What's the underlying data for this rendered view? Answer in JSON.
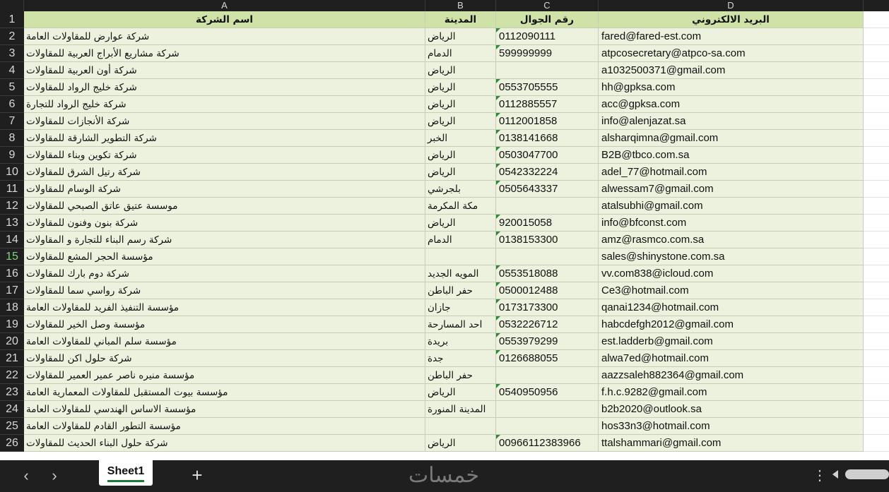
{
  "columns": [
    {
      "letter": "A",
      "width": 568
    },
    {
      "letter": "B",
      "width": 100
    },
    {
      "letter": "C",
      "width": 145
    },
    {
      "letter": "D",
      "width": 375
    }
  ],
  "header": {
    "company": "اسم الشركة",
    "city": "المدينة",
    "mobile": "رقم الجوال",
    "email": "البريد الالكتروني"
  },
  "rows": [
    {
      "n": "2",
      "company": "شركة عوارض للمقاولات العامة",
      "city": "الرياض",
      "mobile": "0112090111",
      "email": "fared@fared-est.com"
    },
    {
      "n": "3",
      "company": "شركة مشاريع الأبراج العربية للمقاولات",
      "city": "الدمام",
      "mobile": "599999999",
      "email": "atpcosecretary@atpco-sa.com"
    },
    {
      "n": "4",
      "company": "شركة أون العربية للمقاولات",
      "city": "الرياض",
      "mobile": "",
      "email": "a1032500371@gmail.com"
    },
    {
      "n": "5",
      "company": "شركة خليج الرواد للمقاولات",
      "city": "الرياض",
      "mobile": "0553705555",
      "email": "hh@gpksa.com"
    },
    {
      "n": "6",
      "company": "شركة خليج الرواد للتجارة",
      "city": "الرياض",
      "mobile": "0112885557",
      "email": "acc@gpksa.com"
    },
    {
      "n": "7",
      "company": "شركة الأنجازات للمقاولات",
      "city": "الرياض",
      "mobile": "0112001858",
      "email": "info@alenjazat.sa"
    },
    {
      "n": "8",
      "company": "شركة التطوير الشارقة للمقاولات",
      "city": "الخبر",
      "mobile": "0138141668",
      "email": "alsharqimna@gmail.com"
    },
    {
      "n": "9",
      "company": "شركة تكوين وبناء للمقاولات",
      "city": "الرياض",
      "mobile": "0503047700",
      "email": "B2B@tbco.com.sa"
    },
    {
      "n": "10",
      "company": "شركة رتيل الشرق للمقاولات",
      "city": "الرياض",
      "mobile": "0542332224",
      "email": "adel_77@hotmail.com"
    },
    {
      "n": "11",
      "company": "شركة الوسام للمقاولات",
      "city": "بلجرشي",
      "mobile": "0505643337",
      "email": "alwessam7@gmail.com"
    },
    {
      "n": "12",
      "company": "موسسة عتيق عاتق الصبحي للمقاولات",
      "city": "مكة المكرمة",
      "mobile": "",
      "email": "atalsubhi@gmail.com"
    },
    {
      "n": "13",
      "company": "شركة بنون وفنون للمقاولات",
      "city": "الرياض",
      "mobile": "920015058",
      "email": "info@bfconst.com"
    },
    {
      "n": "14",
      "company": "شركة رسم البناء للتجارة و المقاولات",
      "city": "الدمام",
      "mobile": "0138153300",
      "email": "amz@rasmco.com.sa"
    },
    {
      "n": "15",
      "company": "مؤسسة الحجر المشع للمقاولات",
      "city": "",
      "mobile": "",
      "email": "sales@shinystone.com.sa"
    },
    {
      "n": "16",
      "company": "شركة دوم بارك للمقاولات",
      "city": "المويه الجديد",
      "mobile": "0553518088",
      "email": "vv.com838@icloud.com"
    },
    {
      "n": "17",
      "company": "شركة رواسي سما للمقاولات",
      "city": "حفر الباطن",
      "mobile": "0500012488",
      "email": "Ce3@hotmail.com"
    },
    {
      "n": "18",
      "company": "مؤسسة التنفيذ الفريد للمقاولات العامة",
      "city": "جازان",
      "mobile": "0173173300",
      "email": "qanai1234@hotmail.com"
    },
    {
      "n": "19",
      "company": "مؤسسة وصل الخير للمقاولات",
      "city": "احد المسارحة",
      "mobile": "0532226712",
      "email": "habcdefgh2012@gmail.com"
    },
    {
      "n": "20",
      "company": "مؤسسة سلم المباني للمقاولات العامة",
      "city": "بريدة",
      "mobile": "0553979299",
      "email": "est.ladderb@gmail.com"
    },
    {
      "n": "21",
      "company": "شركة حلول اكن للمقاولات",
      "city": "جدة",
      "mobile": "0126688055",
      "email": "alwa7ed@hotmail.com"
    },
    {
      "n": "22",
      "company": "مؤسسة منيره ناصر عمير العمير للمقاولات",
      "city": "حفر الباطن",
      "mobile": "",
      "email": "aazzsaleh882364@gmail.com"
    },
    {
      "n": "23",
      "company": "مؤسسة بيوت المستقبل للمقاولات المعمارية العامة",
      "city": "الرياض",
      "mobile": "0540950956",
      "email": "f.h.c.9282@gmail.com"
    },
    {
      "n": "24",
      "company": "مؤسسة الاساس الهندسي للمقاولات العامة",
      "city": "المدينة المنورة",
      "mobile": "",
      "email": "b2b2020@outlook.sa"
    },
    {
      "n": "25",
      "company": "مؤسسة التطور القادم للمقاولات العامة",
      "city": "",
      "mobile": "",
      "email": "hos33n3@hotmail.com"
    },
    {
      "n": "26",
      "company": "شركة حلول البناء الحديث للمقاولات",
      "city": "الرياض",
      "mobile": "00966112383966",
      "email": "ttalshammari@gmail.com"
    }
  ],
  "header_row_number": "1",
  "active_row": "15",
  "tabs": {
    "sheet_name": "Sheet1",
    "add_label": "+",
    "prev": "‹",
    "next": "›",
    "more": "⋮"
  },
  "watermark": "خمسات",
  "colors": {
    "header_fill": "#cfe3a9",
    "row_fill": "#ecf2de",
    "frame": "#1f1f1f",
    "indicator": "#2e8b3e"
  }
}
